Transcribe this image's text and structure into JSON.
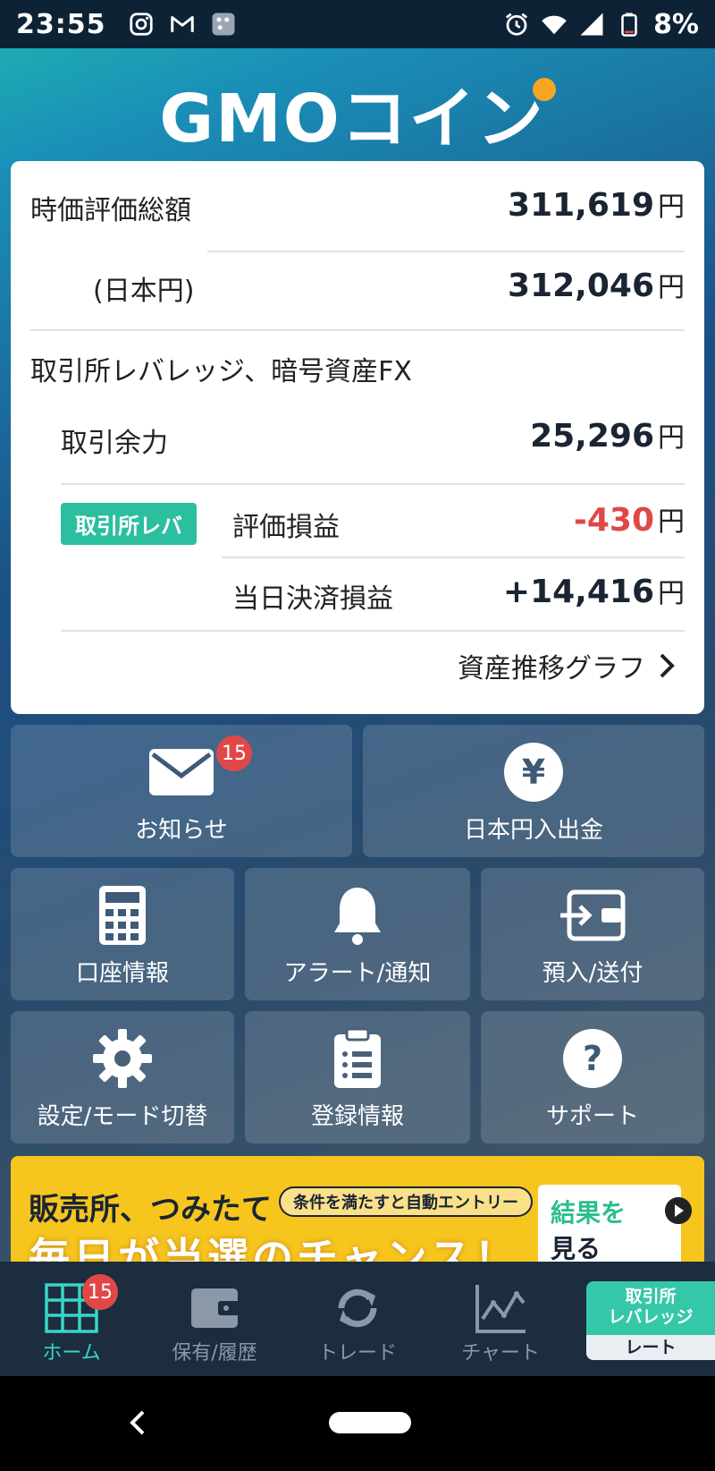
{
  "status_bar": {
    "time": "23:55",
    "battery": "8%",
    "left_icons": [
      "instagram-icon",
      "gmail-icon",
      "app-icon"
    ],
    "right_icons": [
      "alarm-icon",
      "wifi-icon",
      "signal-icon",
      "battery-icon"
    ]
  },
  "logo": {
    "text": "GMOコイン"
  },
  "summary": {
    "total_label": "時価評価総額",
    "total_value": "311,619",
    "jpy_label": "(日本円)",
    "jpy_value": "312,046",
    "section_title": "取引所レバレッジ、暗号資産FX",
    "margin_label": "取引余力",
    "margin_value": "25,296",
    "badge": "取引所レバ",
    "unrealized_label": "評価損益",
    "unrealized_value": "-430",
    "daily_label": "当日決済損益",
    "daily_value": "+14,416",
    "yen_unit": "円",
    "graph_link": "資産推移グラフ"
  },
  "tiles": {
    "news": {
      "label": "お知らせ",
      "badge": "15"
    },
    "jpy_transfer": {
      "label": "日本円入出金"
    },
    "account": {
      "label": "口座情報"
    },
    "alert": {
      "label": "アラート/通知"
    },
    "deposit": {
      "label": "預入/送付"
    },
    "settings": {
      "label": "設定/モード切替"
    },
    "registration": {
      "label": "登録情報"
    },
    "support": {
      "label": "サポート"
    }
  },
  "banner": {
    "title": "販売所、つみたて",
    "pill": "条件を満たすと自動エントリー",
    "big": "毎日が当選のチャンス！",
    "result_line1": "結果を",
    "result_line2": "見る"
  },
  "bottom_nav": {
    "home": "ホーム",
    "home_badge": "15",
    "holdings": "保有/履歴",
    "trade": "トレード",
    "chart": "チャート",
    "rate_top": "取引所\nレバレッジ",
    "rate_bottom": "レート"
  },
  "colors": {
    "accent": "#36d6c8",
    "negative": "#e04848",
    "badge_green": "#2bbfa0",
    "banner_yellow": "#f6c51e"
  }
}
